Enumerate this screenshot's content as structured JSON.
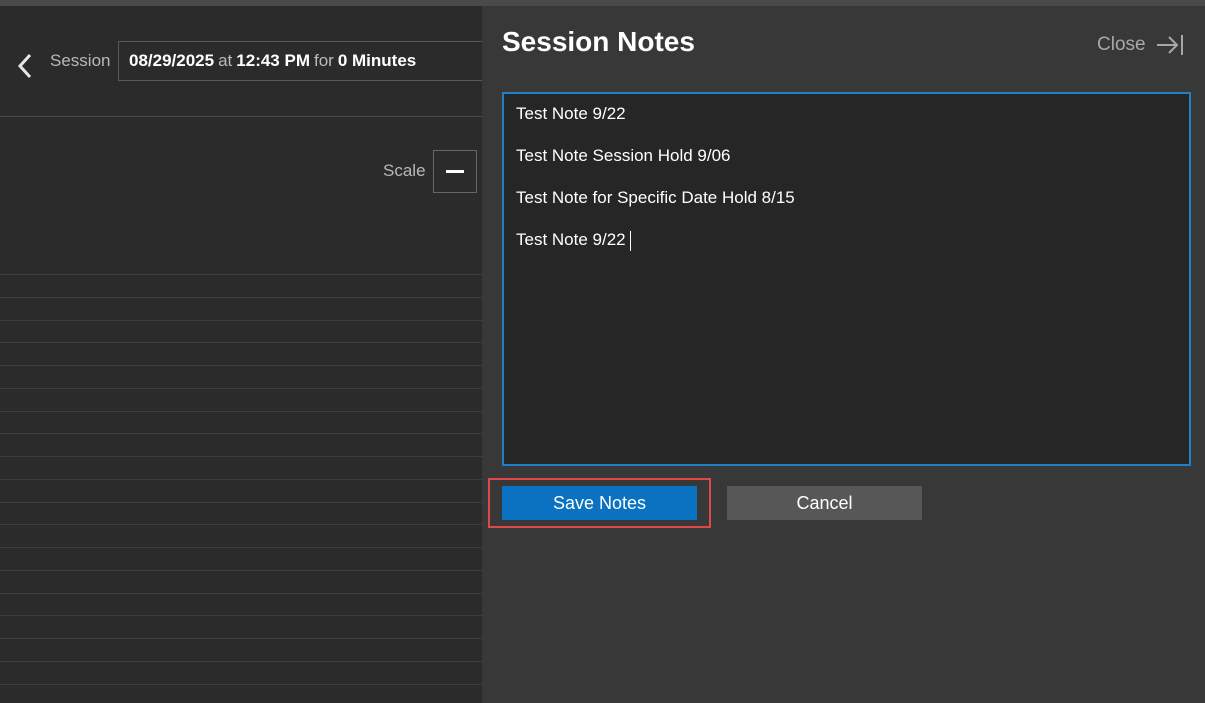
{
  "header": {
    "session_label": "Session",
    "date": "08/29/2025",
    "at_word": "at",
    "time": "12:43 PM",
    "for_word": "for",
    "duration": "0 Minutes"
  },
  "scale": {
    "label": "Scale"
  },
  "panel": {
    "title": "Session Notes",
    "close_label": "Close",
    "notes": [
      "Test Note 9/22",
      "Test Note Session Hold 9/06",
      "Test Note for Specific Date Hold 8/15",
      "Test Note 9/22"
    ],
    "save_label": "Save Notes",
    "cancel_label": "Cancel"
  },
  "colors": {
    "accent": "#0b72c2",
    "focus_border": "#1f7fc8",
    "highlight": "#e0484a",
    "panel_bg": "#383838",
    "app_bg": "#2b2b2b"
  },
  "icons": {
    "back": "chevron-left-icon",
    "close": "close-panel-arrow-icon",
    "scale_minus": "minus-icon"
  }
}
